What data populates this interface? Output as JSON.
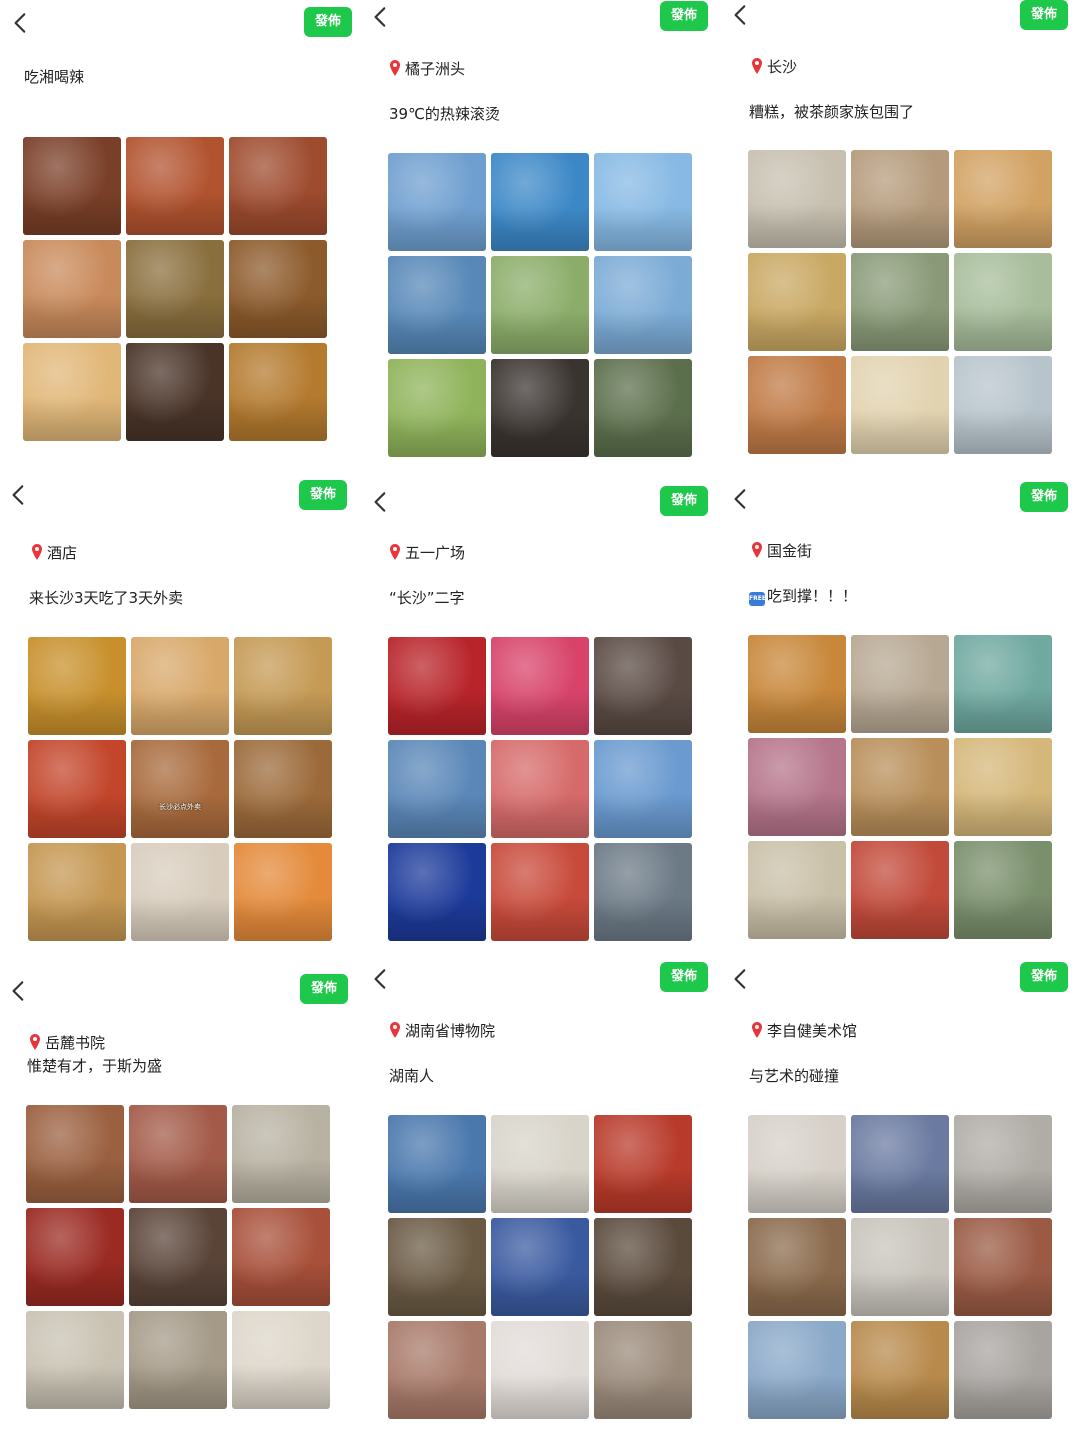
{
  "colors": {
    "post_button": "#1ec84a",
    "pin": "#e8353a"
  },
  "icons": {
    "back": "chevron-left-icon",
    "location": "location-pin-icon",
    "free": "free-badge-icon"
  },
  "panels": [
    {
      "post_label": "發佈",
      "location": "",
      "caption": "吃湘喝辣",
      "photos": [
        {
          "desc": "spicy beef with peppers",
          "color": "#7a3f28"
        },
        {
          "desc": "crawfish bowl",
          "color": "#b2532f"
        },
        {
          "desc": "hotpot with chilies",
          "color": "#9e4b2e"
        },
        {
          "desc": "noodle cup drink",
          "color": "#c98a5b"
        },
        {
          "desc": "set dishes",
          "color": "#8a6f3e"
        },
        {
          "desc": "skewers",
          "color": "#8c5a2b"
        },
        {
          "desc": "egg tofu dish",
          "color": "#e1b778"
        },
        {
          "desc": "stone bowl stew",
          "color": "#4a3428"
        },
        {
          "desc": "stir fried vegetables",
          "color": "#b47a2e"
        }
      ]
    },
    {
      "post_label": "發佈",
      "location": "橘子洲头",
      "caption": "39℃的热辣滚烫",
      "photos": [
        {
          "desc": "statue and skyline",
          "color": "#6f9fd0"
        },
        {
          "desc": "tickets in hand",
          "color": "#3c88c7"
        },
        {
          "desc": "girl by statue",
          "color": "#87b9e4"
        },
        {
          "desc": "river skyline",
          "color": "#5788b8"
        },
        {
          "desc": "statue on lawn",
          "color": "#8cad6a"
        },
        {
          "desc": "river city view",
          "color": "#7cabd6"
        },
        {
          "desc": "girl with sunglasses",
          "color": "#8fb35a"
        },
        {
          "desc": "sunset trees",
          "color": "#3a3430"
        },
        {
          "desc": "window view",
          "color": "#5c6f4c"
        }
      ]
    },
    {
      "post_label": "發佈",
      "location": "长沙",
      "caption": "糟糕，被茶颜家族包围了",
      "photos": [
        {
          "desc": "tea cups",
          "color": "#c7c0b0"
        },
        {
          "desc": "ice cream cones",
          "color": "#b59b7c"
        },
        {
          "desc": "milk tea cup",
          "color": "#d2a263"
        },
        {
          "desc": "snack packs",
          "color": "#c9a863"
        },
        {
          "desc": "drink shelf",
          "color": "#8a9a78"
        },
        {
          "desc": "tea bag pack",
          "color": "#a7bd9b"
        },
        {
          "desc": "iced milk tea",
          "color": "#c07a45"
        },
        {
          "desc": "calligraphy cup",
          "color": "#e2d3b0"
        },
        {
          "desc": "printed cards",
          "color": "#b8c4cc"
        }
      ]
    },
    {
      "post_label": "發佈",
      "location": "酒店",
      "caption": "来长沙3天吃了3天外卖",
      "photos": [
        {
          "desc": "stir fried noodles",
          "color": "#c8902c"
        },
        {
          "desc": "noodle soup",
          "color": "#d8a86a"
        },
        {
          "desc": "mixed noodles",
          "color": "#c59a55"
        },
        {
          "desc": "crawfish",
          "color": "#c3452a"
        },
        {
          "desc": "takeout set",
          "color": "#a86a3c",
          "tag": "长沙必点外卖"
        },
        {
          "desc": "grilled skewers",
          "color": "#9c6a3a"
        },
        {
          "desc": "pastry box",
          "color": "#c59752"
        },
        {
          "desc": "congee cups",
          "color": "#d8cdbd"
        },
        {
          "desc": "fruit platter",
          "color": "#e48a3a"
        }
      ]
    },
    {
      "post_label": "發佈",
      "location": "五一广场",
      "caption": "“长沙”二字",
      "photos": [
        {
          "desc": "red calligraphy wall",
          "color": "#b8242a"
        },
        {
          "desc": "neon sign",
          "color": "#d8436a"
        },
        {
          "desc": "mall sign",
          "color": "#5a4a44"
        },
        {
          "desc": "blue wall sign",
          "color": "#5a87b8"
        },
        {
          "desc": "red tower sign",
          "color": "#d66a6a"
        },
        {
          "desc": "LED wall",
          "color": "#6a9ad0"
        },
        {
          "desc": "blue neon screen",
          "color": "#1c3a9a"
        },
        {
          "desc": "poster wall",
          "color": "#c84a3a"
        },
        {
          "desc": "street sign",
          "color": "#6c7a86"
        }
      ]
    },
    {
      "post_label": "發佈",
      "location": "国金街",
      "caption": "吃到撑！！！",
      "photos": [
        {
          "desc": "snack cups",
          "color": "#c8873a"
        },
        {
          "desc": "printed drink cup",
          "color": "#b7a893"
        },
        {
          "desc": "souvenir shelf",
          "color": "#6fa9a0"
        },
        {
          "desc": "pastry display",
          "color": "#b5758a"
        },
        {
          "desc": "dessert shop",
          "color": "#b88f5a"
        },
        {
          "desc": "milk tea cups",
          "color": "#d5b77a"
        },
        {
          "desc": "bread in hand",
          "color": "#c9c0a8"
        },
        {
          "desc": "spinning wheel",
          "color": "#c24a3a"
        },
        {
          "desc": "ice cream hand",
          "color": "#7a8f6c"
        }
      ]
    },
    {
      "post_label": "發佈",
      "location": "岳麓书院",
      "caption": "惟楚有才，于斯为盛",
      "photos": [
        {
          "desc": "wooden bed room",
          "color": "#9b6040"
        },
        {
          "desc": "red brick building",
          "color": "#a35a48"
        },
        {
          "desc": "memorial gate",
          "color": "#b8b2a2"
        },
        {
          "desc": "red plaque",
          "color": "#9a2a22"
        },
        {
          "desc": "academy gate",
          "color": "#5a4438"
        },
        {
          "desc": "lecture hall",
          "color": "#a8503a"
        },
        {
          "desc": "calligraphy room",
          "color": "#c9c2b3"
        },
        {
          "desc": "exhibit wall",
          "color": "#a59a88"
        },
        {
          "desc": "stone tablet",
          "color": "#ddd6ca"
        }
      ]
    },
    {
      "post_label": "發佈",
      "location": "湖南省博物院",
      "caption": "湖南人",
      "photos": [
        {
          "desc": "museum exterior",
          "color": "#4a78ad"
        },
        {
          "desc": "exhibit book",
          "color": "#d8d4ca"
        },
        {
          "desc": "red moon display",
          "color": "#b83a2a"
        },
        {
          "desc": "bronze vessel",
          "color": "#6a5a44"
        },
        {
          "desc": "light installation",
          "color": "#3a5aa0"
        },
        {
          "desc": "bronze mask",
          "color": "#5a4a3c"
        },
        {
          "desc": "museum hall",
          "color": "#a87a6a"
        },
        {
          "desc": "postcards",
          "color": "#e2dcd8"
        },
        {
          "desc": "atrium crowd",
          "color": "#9a8a7a"
        }
      ]
    },
    {
      "post_label": "發佈",
      "location": "李自健美术馆",
      "caption": "与艺术的碰撞",
      "photos": [
        {
          "desc": "white stairs",
          "color": "#d6d0c8"
        },
        {
          "desc": "gallery poster",
          "color": "#6a7aa0"
        },
        {
          "desc": "stairway",
          "color": "#b0aca6"
        },
        {
          "desc": "large painting",
          "color": "#8a6a4c"
        },
        {
          "desc": "calligraphy wall",
          "color": "#c8c4bc"
        },
        {
          "desc": "framed portrait",
          "color": "#9a5a44"
        },
        {
          "desc": "stone monument",
          "color": "#8aa8c8"
        },
        {
          "desc": "framed artwork",
          "color": "#b88a4c"
        },
        {
          "desc": "gallery hall",
          "color": "#a8a4a0"
        }
      ]
    }
  ]
}
